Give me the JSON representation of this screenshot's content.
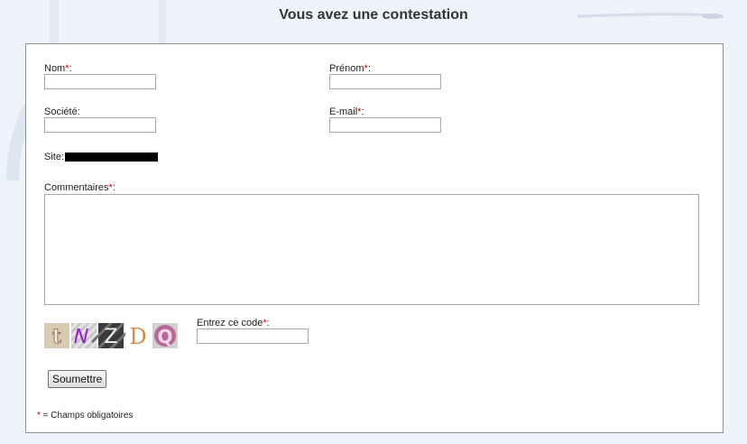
{
  "title": "Vous avez une contestation",
  "form": {
    "nom_label": "Nom",
    "prenom_label": "Prénom",
    "societe_label": "Société",
    "email_label": "E-mail",
    "site_label": "Site:",
    "commentaires_label": "Commentaires",
    "code_label": "Entrez ce code",
    "required_mark": "*",
    "colon": ":",
    "submit_label": "Soumettre",
    "footnote_star": "*",
    "footnote_text": " = Champs obligatoires",
    "captcha_chars": [
      "t",
      "N",
      "Z",
      "D",
      "Q"
    ]
  },
  "colors": {
    "required": "#cc0000",
    "background": "#eef3fa"
  }
}
